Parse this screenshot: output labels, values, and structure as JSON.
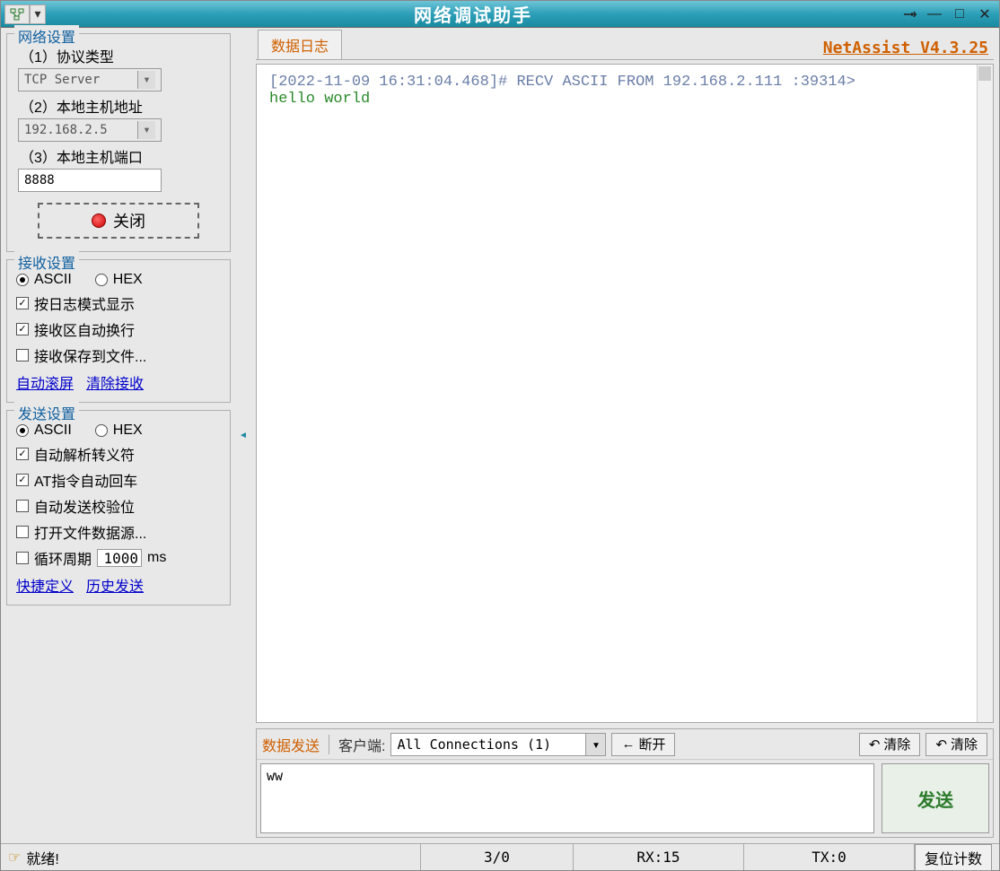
{
  "title": "网络调试助手",
  "version_link": "NetAssist V4.3.25",
  "left": {
    "network_settings_legend": "网络设置",
    "protocol_label": "（1）协议类型",
    "protocol_value": "TCP Server",
    "local_addr_label": "（2）本地主机地址",
    "local_addr_value": "192.168.2.5",
    "local_port_label": "（3）本地主机端口",
    "local_port_value": "8888",
    "close_button": "关闭",
    "recv_settings_legend": "接收设置",
    "recv_ascii": "ASCII",
    "recv_hex": "HEX",
    "recv_log_mode": "按日志模式显示",
    "recv_autowrap": "接收区自动换行",
    "recv_savefile": "接收保存到文件...",
    "recv_autoscroll": "自动滚屏",
    "recv_clear": "清除接收",
    "send_settings_legend": "发送设置",
    "send_ascii": "ASCII",
    "send_hex": "HEX",
    "send_escape": "自动解析转义符",
    "send_at_cr": "AT指令自动回车",
    "send_checksum": "自动发送校验位",
    "send_openfile": "打开文件数据源...",
    "send_cycle_label": "循环周期",
    "send_cycle_value": "1000",
    "send_cycle_unit": "ms",
    "send_shortcut": "快捷定义",
    "send_history": "历史发送"
  },
  "log": {
    "tab_label": "数据日志",
    "timestamp_line": "[2022-11-09 16:31:04.468]# RECV ASCII FROM 192.168.2.111 :39314>",
    "message_line": "hello world"
  },
  "send_area": {
    "data_send_label": "数据发送",
    "client_label": "客户端:",
    "conn_select": "All Connections (1)",
    "disconnect_btn": "断开",
    "clear_btn1": "清除",
    "clear_btn2": "清除",
    "send_text": "ww",
    "send_btn": "发送"
  },
  "status": {
    "ready": "就绪!",
    "seg1": "3/0",
    "rx": "RX:15",
    "tx": "TX:0",
    "reset": "复位计数"
  }
}
